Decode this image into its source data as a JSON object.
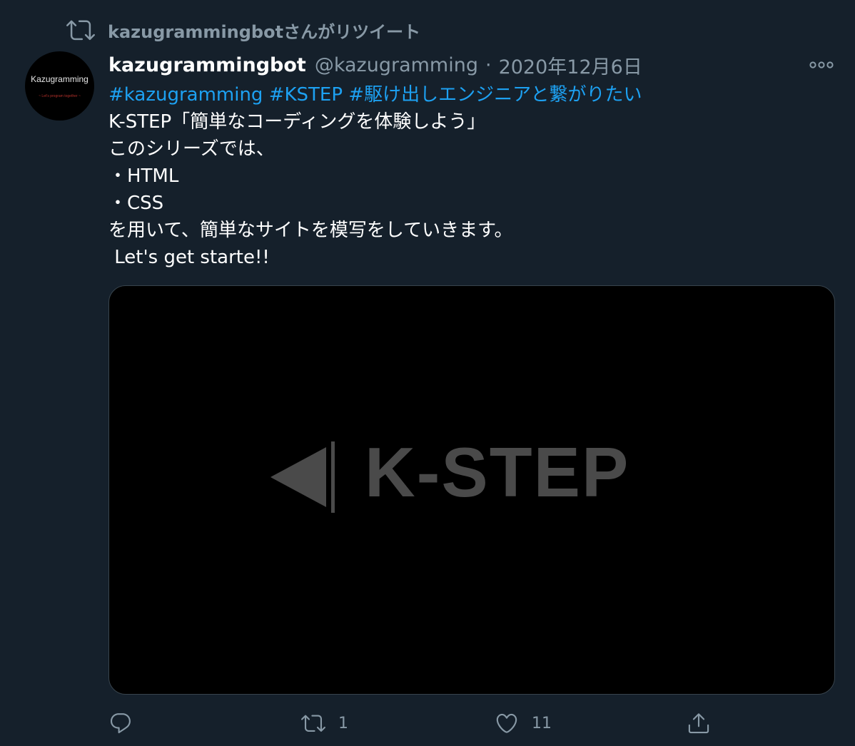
{
  "retweet_context": {
    "text": "kazugrammingbotさんがリツイート",
    "icon": "retweet-icon"
  },
  "avatar": {
    "name": "Kazugramming",
    "tagline": "~ Let's program together ~"
  },
  "author": {
    "display_name": "kazugrammingbot",
    "handle": "@kazugramming",
    "separator": "·",
    "date": "2020年12月6日"
  },
  "more_icon": "more-horizontal-icon",
  "body": {
    "hashtags": [
      "#kazugramming",
      "#KSTEP",
      "#駆け出しエンジニアと繋がりたい"
    ],
    "lines": [
      "K-STEP「簡単なコーディングを体験しよう」",
      "このシリーズでは、",
      "・HTML",
      "・CSS",
      "を用いて、簡単なサイトを模写をしていきます。",
      " Let's get starte!!"
    ]
  },
  "media": {
    "logo_text": "K-STEP",
    "logo_icon": "play-back-icon",
    "background": "#000000",
    "logo_color": "#4a4a4a"
  },
  "actions": {
    "reply": {
      "icon": "reply-icon",
      "count": ""
    },
    "retweet": {
      "icon": "retweet-icon",
      "count": "1"
    },
    "like": {
      "icon": "heart-icon",
      "count": "11"
    },
    "share": {
      "icon": "share-icon",
      "count": ""
    }
  },
  "colors": {
    "background": "#15202b",
    "secondary_text": "#8899a6",
    "link": "#1da1f2",
    "border": "#38444d"
  }
}
